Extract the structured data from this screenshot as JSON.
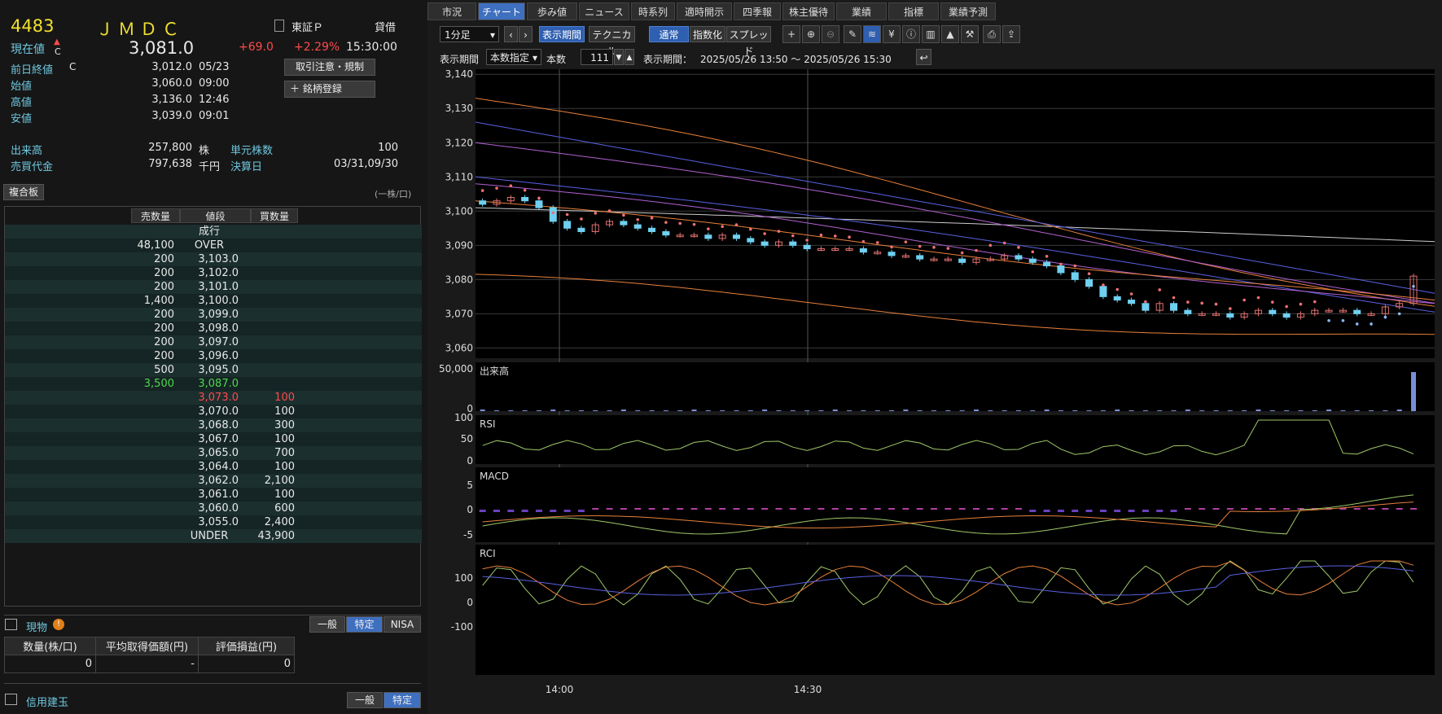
{
  "stock": {
    "code": "4483",
    "name": "ＪＭＤＣ",
    "market": "東証Ｐ",
    "kashikuri": "貸借",
    "current_label": "現在値",
    "arrow": "▲",
    "flag": "C",
    "price": "3,081.0",
    "change": "+69.0",
    "change_pct": "+2.29%",
    "time": "15:30:00"
  },
  "details": [
    {
      "label": "前日終値",
      "flag": "C",
      "value": "3,012.0",
      "time": "05/23"
    },
    {
      "label": "始値",
      "value": "3,060.0",
      "time": "09:00"
    },
    {
      "label": "高値",
      "value": "3,136.0",
      "time": "12:46"
    },
    {
      "label": "安値",
      "value": "3,039.0",
      "time": "09:01"
    }
  ],
  "volume": {
    "label": "出来高",
    "value": "257,800",
    "unit": "株",
    "unit_label": "単元株数",
    "unit_value": "100"
  },
  "turnover": {
    "label": "売買代金",
    "value": "797,638",
    "unit": "千円",
    "settle_label": "決算日",
    "settle_value": "03/31,09/30"
  },
  "buttons": {
    "notice": "取引注意・規制",
    "register": "銘柄登録",
    "register_icon": "＋"
  },
  "board": {
    "title": "複合板",
    "unit_note": "(一株/口)",
    "headers": [
      "売数量",
      "値段",
      "買数量"
    ],
    "rows": [
      {
        "sell": "",
        "price": "成行",
        "buy": ""
      },
      {
        "sell": "48,100",
        "price": "OVER",
        "buy": ""
      },
      {
        "sell": "200",
        "price": "3,103.0",
        "buy": ""
      },
      {
        "sell": "200",
        "price": "3,102.0",
        "buy": ""
      },
      {
        "sell": "200",
        "price": "3,101.0",
        "buy": ""
      },
      {
        "sell": "1,400",
        "price": "3,100.0",
        "buy": ""
      },
      {
        "sell": "200",
        "price": "3,099.0",
        "buy": ""
      },
      {
        "sell": "200",
        "price": "3,098.0",
        "buy": ""
      },
      {
        "sell": "200",
        "price": "3,097.0",
        "buy": ""
      },
      {
        "sell": "200",
        "price": "3,096.0",
        "buy": ""
      },
      {
        "sell": "500",
        "price": "3,095.0",
        "buy": ""
      },
      {
        "sell": "3,500",
        "price": "3,087.0",
        "buy": "",
        "color": "#4ed84e"
      },
      {
        "sell": "",
        "price": "3,073.0",
        "buy": "100",
        "color": "#ff4a4a"
      },
      {
        "sell": "",
        "price": "3,070.0",
        "buy": "100"
      },
      {
        "sell": "",
        "price": "3,068.0",
        "buy": "300"
      },
      {
        "sell": "",
        "price": "3,067.0",
        "buy": "100"
      },
      {
        "sell": "",
        "price": "3,065.0",
        "buy": "700"
      },
      {
        "sell": "",
        "price": "3,064.0",
        "buy": "100"
      },
      {
        "sell": "",
        "price": "3,062.0",
        "buy": "2,100"
      },
      {
        "sell": "",
        "price": "3,061.0",
        "buy": "100"
      },
      {
        "sell": "",
        "price": "3,060.0",
        "buy": "600"
      },
      {
        "sell": "",
        "price": "3,055.0",
        "buy": "2,400"
      },
      {
        "sell": "",
        "price": "UNDER",
        "buy": "43,900"
      }
    ]
  },
  "holdings": {
    "title": "現物",
    "seg": [
      "一般",
      "特定",
      "NISA"
    ],
    "headers": [
      "数量(株/口)",
      "平均取得価額(円)",
      "評価損益(円)"
    ],
    "values": [
      "0",
      "-",
      "0"
    ]
  },
  "margin": {
    "title": "信用建玉",
    "seg": [
      "一般",
      "特定"
    ]
  },
  "tabs": [
    "市況",
    "チャート",
    "歩み値",
    "ニュース",
    "時系列",
    "適時開示",
    "四季報",
    "株主優待",
    "業績",
    "指標",
    "業績予測"
  ],
  "toolbar": {
    "interval": "1分足",
    "period_btn": "表示期間",
    "technical_btn": "テクニカル",
    "normal_btn": "通常",
    "index_btn": "指数化",
    "spread_btn": "スプレッド",
    "period_label": "表示期間",
    "period_mode": "本数指定",
    "count_label": "本数",
    "count": "111",
    "range_label": "表示期間：",
    "range": "2025/05/26 13:50 ～ 2025/05/26 15:30"
  },
  "chart_data": {
    "type": "candlestick",
    "price_axis": [
      "3,140",
      "3,130",
      "3,120",
      "3,110",
      "3,100",
      "3,090",
      "3,080",
      "3,070",
      "3,060"
    ],
    "ylim": [
      3057,
      3141
    ],
    "x_ticks": [
      "14:00",
      "14:30"
    ],
    "panels": [
      {
        "name": "出来高",
        "ticks": [
          "50,000",
          "0"
        ]
      },
      {
        "name": "RSI",
        "ticks": [
          "100",
          "50",
          "0"
        ]
      },
      {
        "name": "MACD",
        "ticks": [
          "5",
          "0",
          "-5"
        ]
      },
      {
        "name": "RCI",
        "ticks": [
          "100",
          "0",
          "-100"
        ]
      }
    ],
    "closes": [
      3102,
      3103,
      3104,
      3103,
      3101,
      3097,
      3095,
      3094,
      3096,
      3097,
      3096,
      3095,
      3094,
      3093,
      3093,
      3093,
      3092,
      3093,
      3092,
      3091,
      3090,
      3091,
      3090,
      3089,
      3089,
      3089,
      3089,
      3088,
      3088,
      3087,
      3087,
      3086,
      3086,
      3086,
      3085,
      3086,
      3086,
      3087,
      3086,
      3085,
      3084,
      3082,
      3080,
      3078,
      3075,
      3074,
      3073,
      3071,
      3073,
      3071,
      3070,
      3070,
      3070,
      3069,
      3070,
      3071,
      3070,
      3069,
      3070,
      3071,
      3071,
      3071,
      3070,
      3070,
      3072,
      3073,
      3081
    ],
    "colors": {
      "up": "#e07070",
      "down": "#6fd0f0",
      "ma_orange": "#e8803a",
      "bb_purple": "#b060d0",
      "ma_blue": "#5a60e0",
      "psar": "#f07070",
      "ma_white": "#cccccc",
      "volume": "#7a8fd8",
      "macd_hist": "#b040a0",
      "macd_hist_neg": "#6a40c0",
      "rsi": "#a0c868",
      "rci_green": "#a0c868",
      "rci_orange": "#e8803a",
      "rci_blue": "#5a60e0"
    }
  }
}
